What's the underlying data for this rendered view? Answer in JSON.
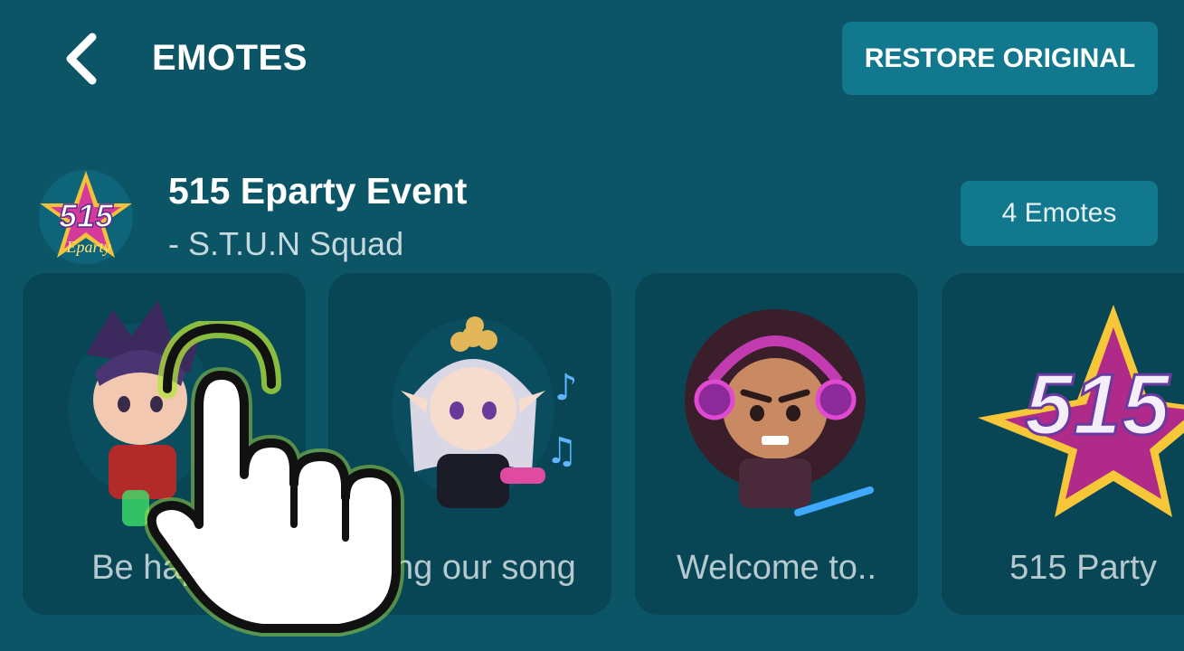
{
  "header": {
    "back_icon": "chevron-left-icon",
    "title": "EMOTES",
    "restore_label": "RESTORE ORIGINAL"
  },
  "event": {
    "logo_text": "515",
    "logo_script": "Eparty",
    "title": "515 Eparty Event",
    "subtitle": "- S.T.U.N Squad",
    "count_label": "4 Emotes"
  },
  "emotes": [
    {
      "label": "Be happy",
      "icon": "dark-hair-hero-emote"
    },
    {
      "label": "Sing our song",
      "icon": "elf-singer-emote"
    },
    {
      "label": "Welcome to..",
      "icon": "dj-headphones-emote"
    },
    {
      "label": "515 Party",
      "icon": "515-star-emote"
    }
  ],
  "overlay": {
    "icon": "tap-hand-icon"
  },
  "colors": {
    "background": "#0b5566",
    "button": "#11788d",
    "card": "#084656",
    "card_label": "#b5c9ce",
    "tap_glow": "#b4e53a"
  }
}
